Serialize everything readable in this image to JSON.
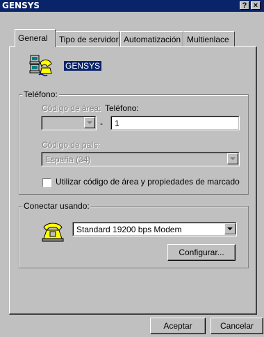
{
  "window": {
    "title": "GENSYS",
    "help_button": "?",
    "close_button": "×"
  },
  "tabs": [
    {
      "label": "General",
      "active": true
    },
    {
      "label": "Tipo de servidor",
      "active": false
    },
    {
      "label": "Automatización",
      "active": false
    },
    {
      "label": "Multienlace",
      "active": false
    }
  ],
  "connection": {
    "name": "GENSYS",
    "icon": "network-computers-icon"
  },
  "phone_group": {
    "legend": "Teléfono:",
    "area_code_label": "Código de área:",
    "area_code_value": "",
    "phone_label": "Teléfono:",
    "phone_separator": "-",
    "phone_value": "1",
    "country_label": "Código de país:",
    "country_value": "España (34)",
    "use_area_code_checkbox": "Utilizar código de área y propiedades de marcado",
    "use_area_code_checked": false
  },
  "connect_group": {
    "legend": "Conectar usando:",
    "modem_icon": "telephone-icon",
    "modem_value": "Standard 19200 bps Modem",
    "configure_button": "Configurar..."
  },
  "footer": {
    "ok_button": "Aceptar",
    "cancel_button": "Cancelar"
  }
}
